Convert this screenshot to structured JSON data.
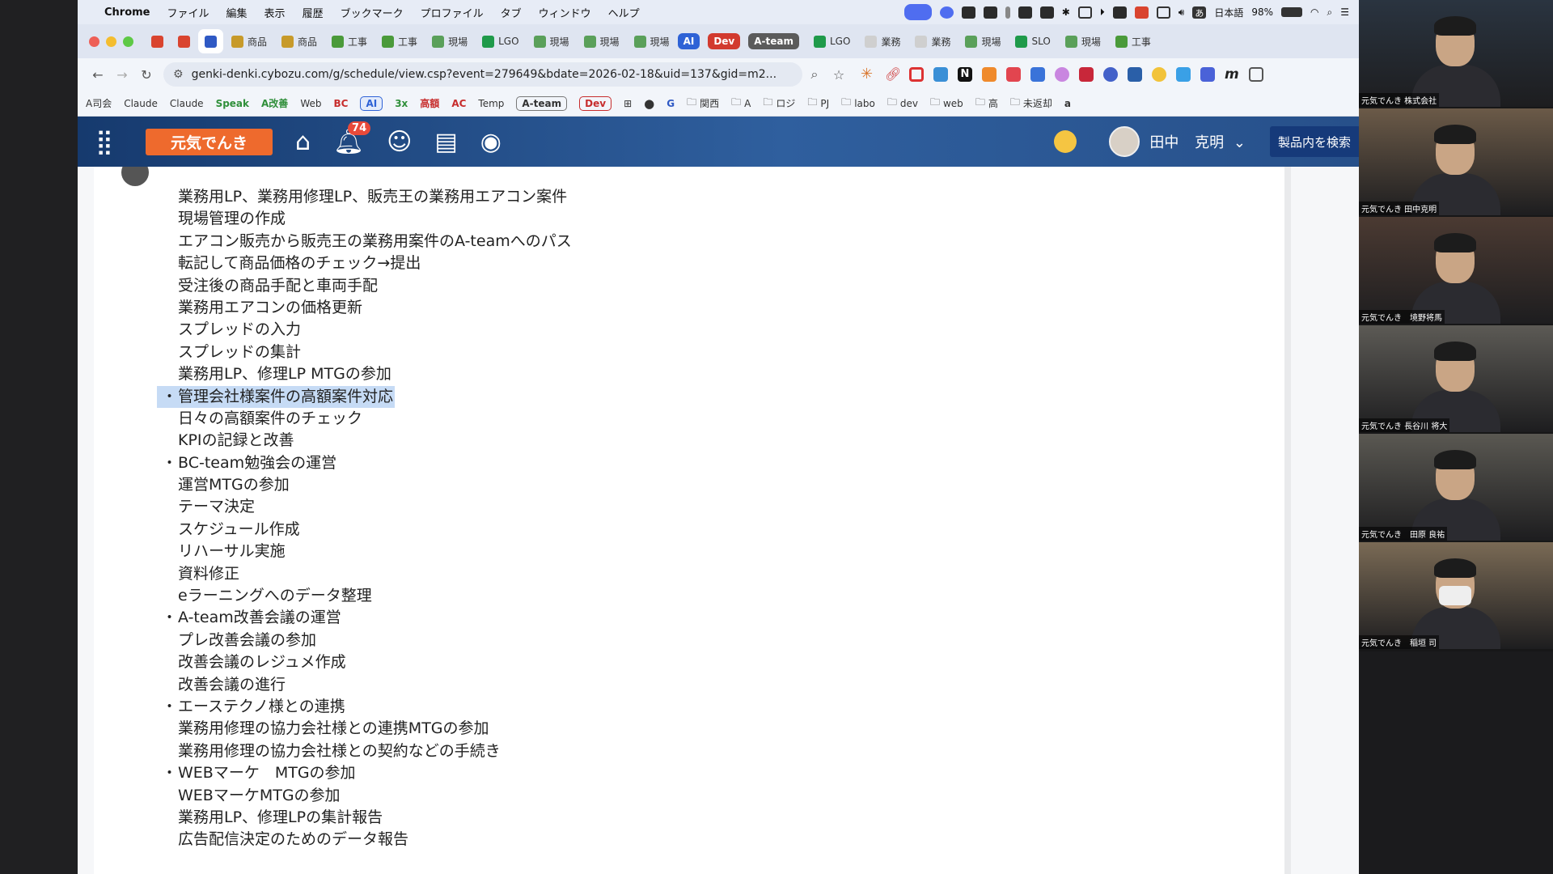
{
  "menubar": {
    "apple": "",
    "items": [
      "Chrome",
      "ファイル",
      "編集",
      "表示",
      "履歴",
      "ブックマーク",
      "プロファイル",
      "タブ",
      "ウィンドウ",
      "ヘルプ"
    ],
    "input_method": "日本語",
    "battery": "98%"
  },
  "tabs": [
    {
      "label": "",
      "icon": "gmail-icon",
      "color": "#d9442f"
    },
    {
      "label": "",
      "icon": "gmail-icon",
      "color": "#d9442f"
    },
    {
      "label": "",
      "icon": "g-icon",
      "color": "#2f59c4",
      "active": true
    },
    {
      "label": "商品",
      "icon": "doc-icon",
      "color": "#c79a2a"
    },
    {
      "label": "商品",
      "icon": "doc-icon",
      "color": "#c79a2a"
    },
    {
      "label": "工事",
      "icon": "sheet-icon",
      "color": "#4a9a3a"
    },
    {
      "label": "工事",
      "icon": "sheet-icon",
      "color": "#4a9a3a"
    },
    {
      "label": "現場",
      "icon": "chart-icon",
      "color": "#5aa05a"
    },
    {
      "label": "LGO",
      "icon": "plus-icon",
      "color": "#1f9a4a"
    },
    {
      "label": "現場",
      "icon": "chart-icon",
      "color": "#5aa05a"
    },
    {
      "label": "現場",
      "icon": "chart-icon",
      "color": "#5aa05a"
    },
    {
      "label": "現場",
      "icon": "chart-icon",
      "color": "#5aa05a"
    }
  ],
  "tab_pills": [
    {
      "label": "AI",
      "color": "#2e62d6"
    },
    {
      "label": "Dev",
      "color": "#d23a2e"
    },
    {
      "label": "A-team",
      "color": "#5b5b5b"
    }
  ],
  "tabs_after": [
    {
      "label": "LGO",
      "icon": "plus-icon",
      "color": "#1f9a4a"
    },
    {
      "label": "業務",
      "icon": "line-icon",
      "color": "#cfcfcf"
    },
    {
      "label": "業務",
      "icon": "line-icon",
      "color": "#cfcfcf"
    },
    {
      "label": "現場",
      "icon": "chart-icon",
      "color": "#5aa05a"
    },
    {
      "label": "SLO",
      "icon": "plus-icon",
      "color": "#1f9a4a"
    },
    {
      "label": "現場",
      "icon": "chart-icon",
      "color": "#5aa05a"
    },
    {
      "label": "工事",
      "icon": "sheet-icon",
      "color": "#4a9a3a"
    }
  ],
  "address": {
    "url": "genki-denki.cybozu.com/g/schedule/view.csp?event=279649&bdate=2026-02-18&uid=137&gid=m2..."
  },
  "bookmarks": [
    {
      "label": "A司会",
      "style": "plain"
    },
    {
      "label": "Claude",
      "style": "plain"
    },
    {
      "label": "Claude",
      "style": "plain"
    },
    {
      "label": "Speak",
      "style": "green"
    },
    {
      "label": "A改善",
      "style": "green"
    },
    {
      "label": "Web",
      "style": "plain"
    },
    {
      "label": "BC",
      "style": "red"
    },
    {
      "label": "AI",
      "style": "box-blue"
    },
    {
      "label": "3x",
      "style": "green"
    },
    {
      "label": "高額",
      "style": "red"
    },
    {
      "label": "AC",
      "style": "red"
    },
    {
      "label": "Temp",
      "style": "plain"
    },
    {
      "label": "A-team",
      "style": "box"
    },
    {
      "label": "Dev",
      "style": "box-red"
    }
  ],
  "bookmark_folders": [
    "関西",
    "A",
    "ロジ",
    "PJ",
    "labo",
    "dev",
    "web",
    "高",
    "未返却"
  ],
  "app_header": {
    "logo": "元気でんき",
    "notification_count": "74",
    "user_first": "田中",
    "user_last": "克明",
    "search_label": "製品内を検索"
  },
  "content": {
    "lines": [
      {
        "text": "業務用LP、業務用修理LP、販売王の業務用エアコン案件",
        "bullet": false
      },
      {
        "text": "現場管理の作成",
        "bullet": false
      },
      {
        "text": "エアコン販売から販売王の業務用案件のA-teamへのパス",
        "bullet": false
      },
      {
        "text": "転記して商品価格のチェック→提出",
        "bullet": false
      },
      {
        "text": "受注後の商品手配と車両手配",
        "bullet": false
      },
      {
        "text": "業務用エアコンの価格更新",
        "bullet": false
      },
      {
        "text": "スプレッドの入力",
        "bullet": false
      },
      {
        "text": "スプレッドの集計",
        "bullet": false
      },
      {
        "text": "業務用LP、修理LP MTGの参加",
        "bullet": false
      },
      {
        "text": "管理会社様案件の高額案件対応",
        "bullet": true,
        "highlight": true
      },
      {
        "text": "日々の高額案件のチェック",
        "bullet": false
      },
      {
        "text": "KPIの記録と改善",
        "bullet": false
      },
      {
        "text": "BC-team勉強会の運営",
        "bullet": true
      },
      {
        "text": "運営MTGの参加",
        "bullet": false
      },
      {
        "text": "テーマ決定",
        "bullet": false
      },
      {
        "text": "スケジュール作成",
        "bullet": false
      },
      {
        "text": "リハーサル実施",
        "bullet": false
      },
      {
        "text": "資料修正",
        "bullet": false
      },
      {
        "text": "eラーニングへのデータ整理",
        "bullet": false
      },
      {
        "text": "A-team改善会議の運営",
        "bullet": true
      },
      {
        "text": "プレ改善会議の参加",
        "bullet": false
      },
      {
        "text": "改善会議のレジュメ作成",
        "bullet": false
      },
      {
        "text": "改善会議の進行",
        "bullet": false
      },
      {
        "text": "エーステクノ様との連携",
        "bullet": true
      },
      {
        "text": "業務用修理の協力会社様との連携MTGの参加",
        "bullet": false
      },
      {
        "text": "業務用修理の協力会社様との契約などの手続き",
        "bullet": false
      },
      {
        "text": "WEBマーケ　MTGの参加",
        "bullet": true
      },
      {
        "text": "WEBマーケMTGの参加",
        "bullet": false
      },
      {
        "text": "業務用LP、修理LPの集計報告",
        "bullet": false
      },
      {
        "text": "広告配信決定のためのデータ報告",
        "bullet": false
      }
    ]
  },
  "participants": [
    {
      "name": "元気でんき 株式会社",
      "mask": false,
      "bg": "#2a3440"
    },
    {
      "name": "元気でんき 田中克明",
      "mask": false,
      "bg": "#6b5a48"
    },
    {
      "name": "元気でんき　境野将馬",
      "mask": false,
      "bg": "#4b3a32"
    },
    {
      "name": "元気でんき 長谷川 将大",
      "mask": false,
      "bg": "#5c5a55"
    },
    {
      "name": "元気でんき　田原 良祐",
      "mask": false,
      "bg": "#5a5852"
    },
    {
      "name": "元気でんき　稲垣 司",
      "mask": true,
      "bg": "#7a6a55"
    }
  ]
}
